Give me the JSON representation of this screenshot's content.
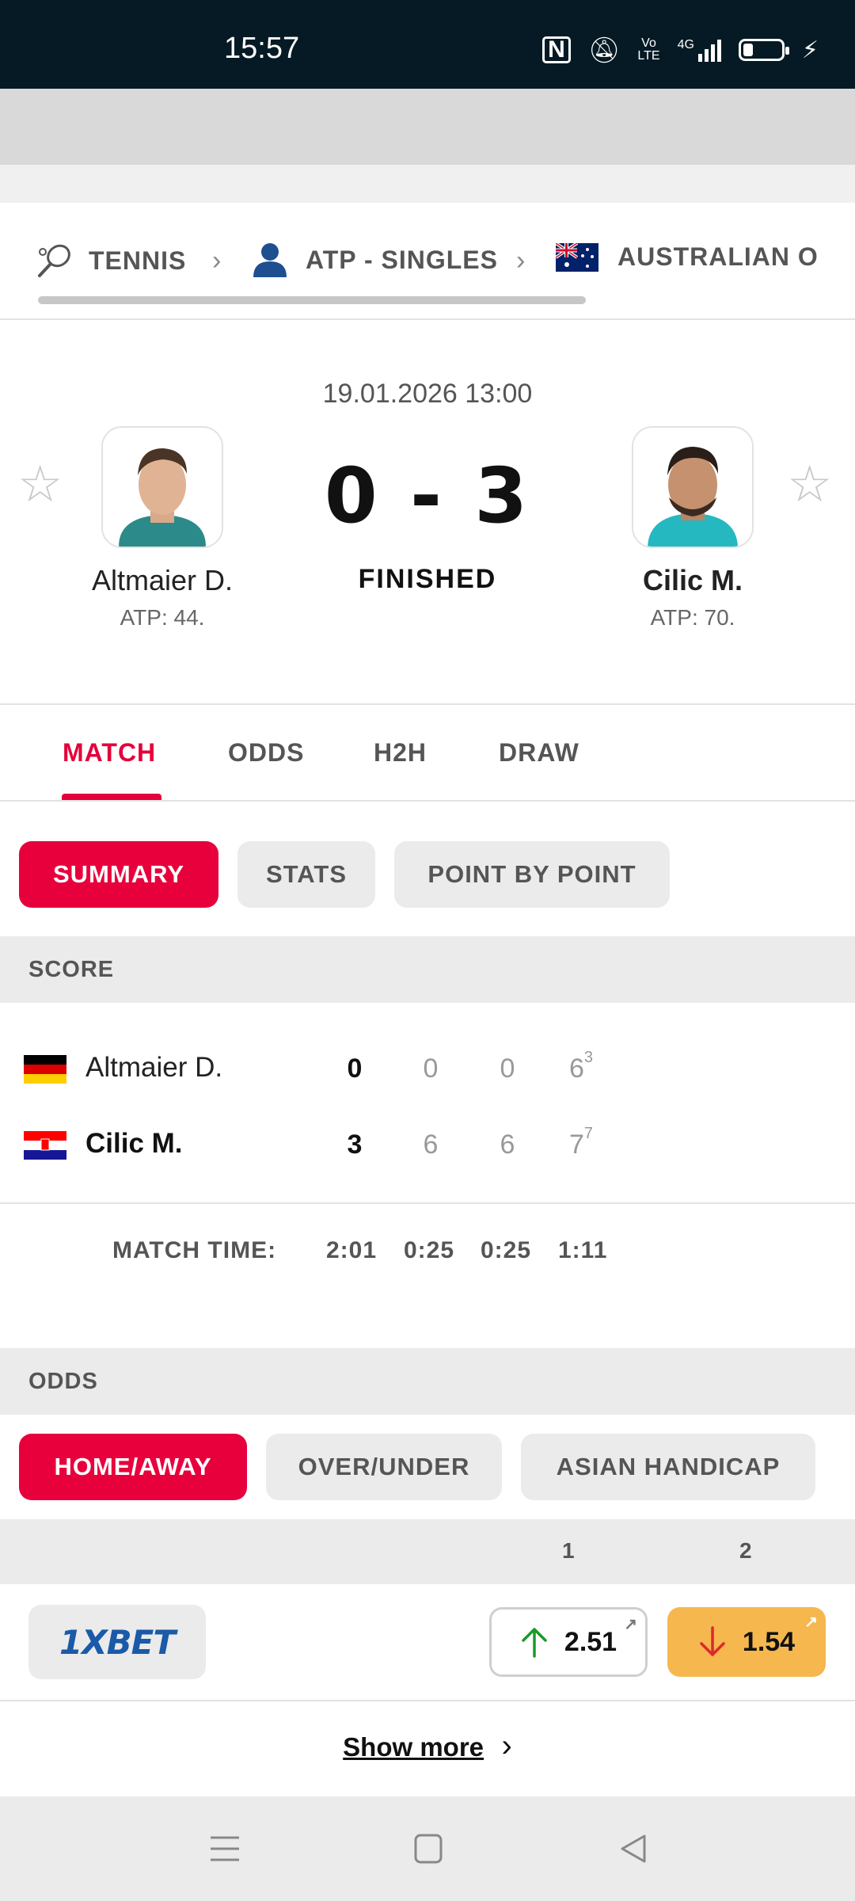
{
  "status_bar": {
    "time": "15:57",
    "network": "4G"
  },
  "breadcrumb": {
    "items": [
      {
        "label": "TENNIS",
        "icon": "tennis-racket-icon"
      },
      {
        "label": "ATP - SINGLES",
        "icon": "person-icon"
      },
      {
        "label": "AUSTRALIAN O",
        "icon": "australia-flag-icon"
      }
    ]
  },
  "match": {
    "datetime": "19.01.2026 13:00",
    "score": "0 - 3",
    "status": "FINISHED",
    "home": {
      "name": "Altmaier D.",
      "rank": "ATP: 44."
    },
    "away": {
      "name": "Cilic M.",
      "rank": "ATP: 70."
    }
  },
  "tabs": [
    "MATCH",
    "ODDS",
    "H2H",
    "DRAW"
  ],
  "subtabs": [
    "SUMMARY",
    "STATS",
    "POINT BY POINT"
  ],
  "score_section": {
    "title": "SCORE",
    "rows": [
      {
        "name": "Altmaier D.",
        "total": "0",
        "sets": [
          "0",
          "0",
          "6"
        ],
        "tiebreak": "3"
      },
      {
        "name": "Cilic M.",
        "total": "3",
        "sets": [
          "6",
          "6",
          "7"
        ],
        "tiebreak": "7"
      }
    ],
    "match_time_label": "MATCH TIME:",
    "match_times": [
      "2:01",
      "0:25",
      "0:25",
      "1:11"
    ]
  },
  "odds_section": {
    "title": "ODDS",
    "tabs": [
      "HOME/AWAY",
      "OVER/UNDER",
      "ASIAN HANDICAP"
    ],
    "col1": "1",
    "col2": "2",
    "bookmaker": "1XBET",
    "odd1": "2.51",
    "odd2": "1.54",
    "show_more": "Show more"
  },
  "colors": {
    "accent": "#e4003a",
    "odds_highlight": "#f5b74e",
    "status_bar": "#051a24"
  }
}
